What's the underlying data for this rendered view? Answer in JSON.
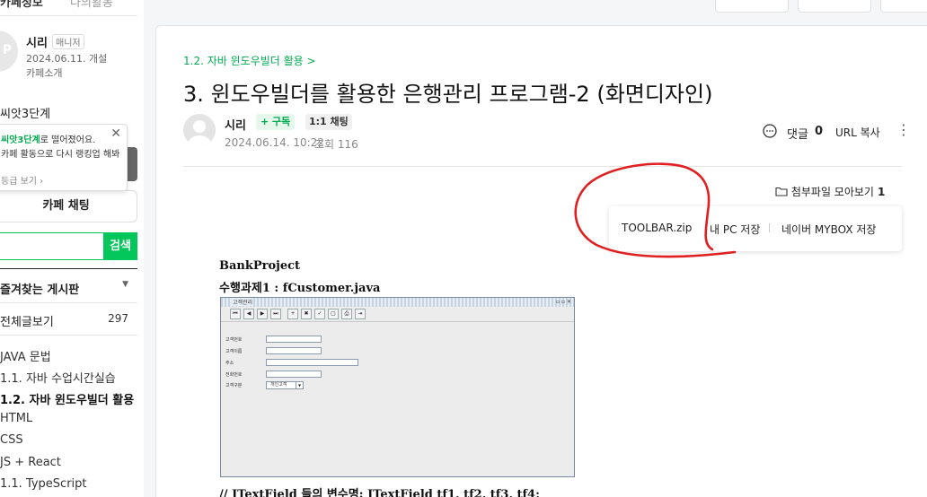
{
  "sidebar": {
    "tab_info": "카페정보",
    "tab_activity": "나의활동",
    "profile": {
      "name": "시리",
      "badge": "매니저",
      "created": "2024.06.11. 개설",
      "intro": "카페소개"
    },
    "level": "씨앗3단계",
    "popup": {
      "line1_highlight": "씨앗3단계",
      "line1_rest": "로 떨어졌어요.",
      "line2": "카페 활동으로 다시 랭킹업 해봐",
      "link": "등급 보기"
    },
    "chat_button": "카페 채팅",
    "search_button": "검색",
    "favorites_title": "즐겨찾는 게시판",
    "all_posts": {
      "label": "전체글보기",
      "count": "297"
    },
    "menu": [
      {
        "label": "JAVA 문법",
        "active": false
      },
      {
        "label": "1.1. 자바 수업시간실습",
        "active": false
      },
      {
        "label": "1.2. 자바 윈도우빌더 활용",
        "active": true
      },
      {
        "label": "HTML",
        "active": false
      },
      {
        "label": "CSS",
        "active": false
      },
      {
        "label": "JS + React",
        "active": false
      },
      {
        "label": "1.1. TypeScript",
        "active": false
      }
    ]
  },
  "article": {
    "breadcrumb": "1.2. 자바 윈도우빌더 활용 >",
    "title": "3. 윈도우빌더를 활용한 은행관리 프로그램-2 (화면디자인)",
    "author": "시리",
    "follow_button": "+ 구독",
    "chat_button": "1:1 채팅",
    "date": "2024.06.14. 10:22",
    "views": "조회 116",
    "comment_label": "댓글",
    "comment_count": "0",
    "url_copy": "URL 복사",
    "attachments": {
      "label": "첨부파일 모아보기",
      "count": "1",
      "file_name": "TOOLBAR.zip",
      "pc_save": "내 PC 저장",
      "mybox_save": "네이버 MYBOX 저장"
    },
    "body_line1": "BankProject",
    "body_line2": "수행과제1 : fCustomer.java",
    "body_line3": "// JTextField 들의 변수명:  JTextField tf1, tf2, tf3, tf4;"
  },
  "swing_window": {
    "title": "고객관리",
    "toolbar_buttons": [
      "⏮",
      "◀",
      "▶",
      "⏭",
      "+",
      "✖",
      "✓",
      "▢",
      "⎙",
      "⇥"
    ],
    "fields": [
      {
        "label": "고객번호"
      },
      {
        "label": "고객이름"
      },
      {
        "label": "주소"
      },
      {
        "label": "전화번호"
      }
    ],
    "combo_label": "고객구분",
    "combo_value": "개인고객"
  },
  "colors": {
    "accent": "#03c75a",
    "accent_text": "#03a94f",
    "annotation": "#e02020"
  }
}
